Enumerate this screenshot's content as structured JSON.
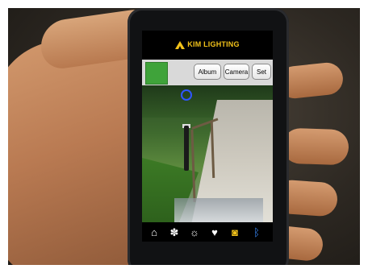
{
  "app": {
    "brand": "KIM LIGHTING",
    "brand_color": "#f2c21a"
  },
  "toolbar": {
    "swatch_color": "#3fa33a",
    "album_label": "Album",
    "camera_label": "Camera",
    "set_label": "Set"
  },
  "tabbar": {
    "items": [
      {
        "icon": "home-icon",
        "glyph": "⌂"
      },
      {
        "icon": "palette-icon",
        "glyph": "✽"
      },
      {
        "icon": "brightness-icon",
        "glyph": "☼"
      },
      {
        "icon": "heart-icon",
        "glyph": "♥"
      },
      {
        "icon": "camera-icon",
        "glyph": "◙"
      },
      {
        "icon": "bluetooth-icon",
        "glyph": "ᛒ"
      }
    ],
    "active_color": "#f2c21a",
    "bluetooth_color": "#3a8cff"
  }
}
